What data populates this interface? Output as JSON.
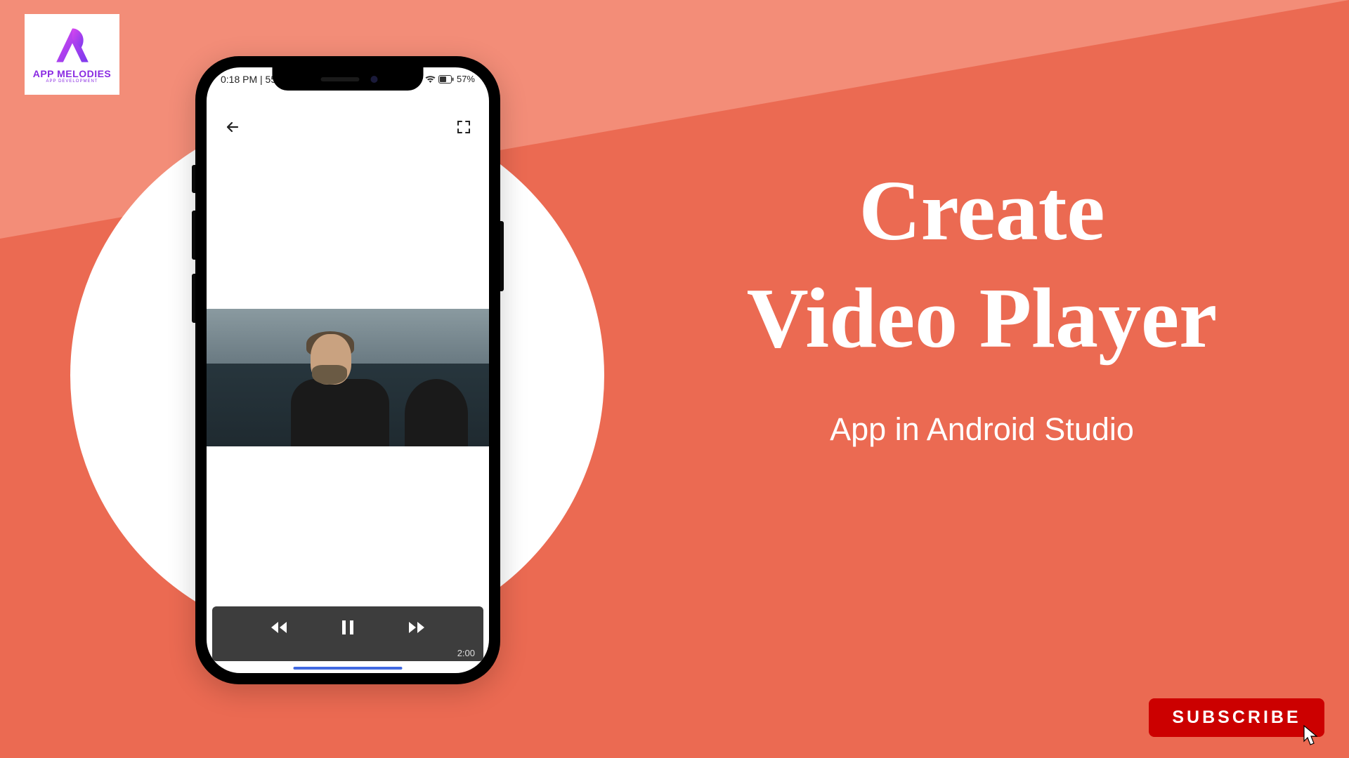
{
  "logo": {
    "name": "APP MELODIES",
    "tagline": "APP DEVELOPMENT"
  },
  "phone": {
    "statusbar": {
      "time": "0:18 PM | 55.",
      "battery": "57%"
    },
    "media": {
      "duration": "2:00"
    }
  },
  "title": {
    "line1": "Create",
    "line2": "Video Player",
    "subtitle": "App in Android Studio"
  },
  "subscribe_label": "SUBSCRIBE"
}
